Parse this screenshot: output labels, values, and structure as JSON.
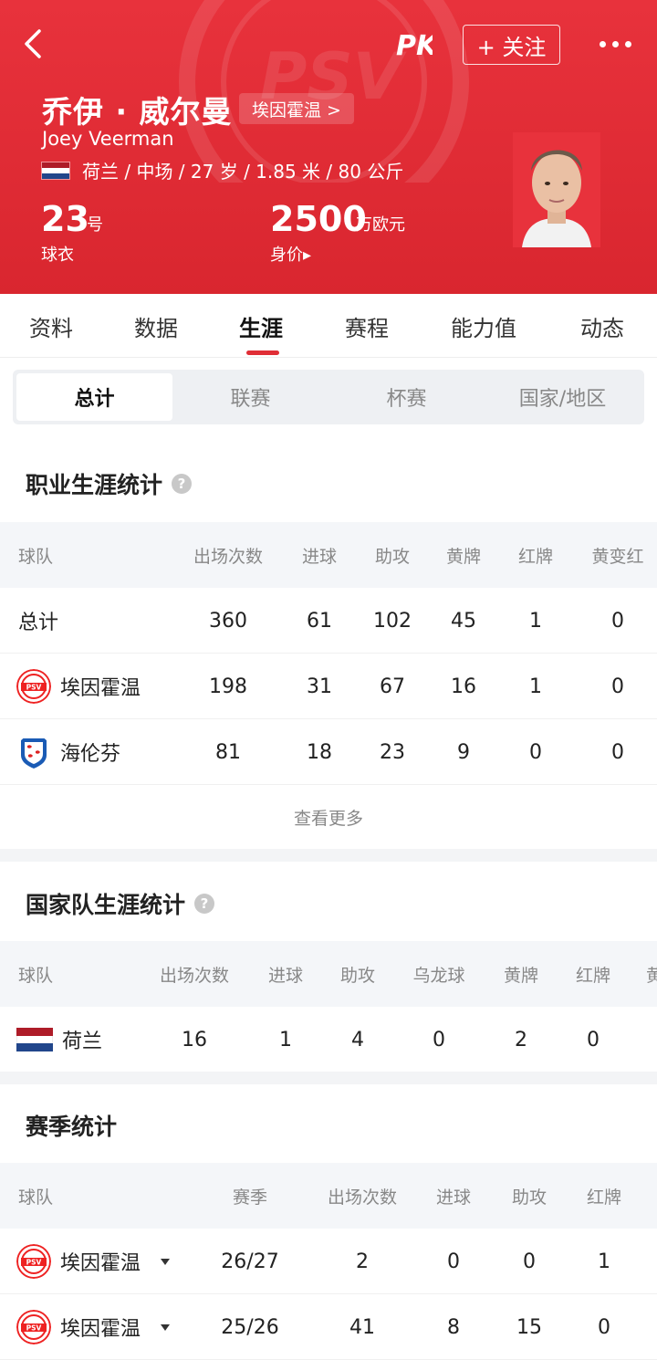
{
  "header": {
    "name_cn": "乔伊 · 威尔曼",
    "club_link": "埃因霍温 >",
    "name_en": "Joey Veerman",
    "profile_line": "荷兰 / 中场 / 27 岁 / 1.85 米 / 80 公斤",
    "shirt_number": "23",
    "shirt_unit": "号",
    "shirt_label": "球衣",
    "value_number": "2500",
    "value_unit": "万欧元",
    "value_label": "身价▸",
    "follow_label": "+ 关注",
    "brand_color": "#e02e36"
  },
  "tabs": [
    "资料",
    "数据",
    "生涯",
    "赛程",
    "能力值",
    "动态"
  ],
  "active_tab": "生涯",
  "segments": [
    "总计",
    "联赛",
    "杯赛",
    "国家/地区"
  ],
  "career": {
    "title": "职业生涯统计",
    "columns": [
      "球队",
      "出场次数",
      "进球",
      "助攻",
      "黄牌",
      "红牌",
      "黄变红"
    ],
    "rows": [
      {
        "team": "总计",
        "apps": "360",
        "goals": "61",
        "assists": "102",
        "yellow": "45",
        "red": "1",
        "yr": "0"
      },
      {
        "team": "埃因霍温",
        "apps": "198",
        "goals": "31",
        "assists": "67",
        "yellow": "16",
        "red": "1",
        "yr": "0"
      },
      {
        "team": "海伦芬",
        "apps": "81",
        "goals": "18",
        "assists": "23",
        "yellow": "9",
        "red": "0",
        "yr": "0"
      }
    ],
    "more_label": "查看更多"
  },
  "national": {
    "title": "国家队生涯统计",
    "columns": [
      "球队",
      "出场次数",
      "进球",
      "助攻",
      "乌龙球",
      "黄牌",
      "红牌",
      "黄"
    ],
    "rows": [
      {
        "team": "荷兰",
        "apps": "16",
        "goals": "1",
        "assists": "4",
        "own": "0",
        "yellow": "2",
        "red": "0"
      }
    ]
  },
  "season": {
    "title": "赛季统计",
    "columns": [
      "球队",
      "赛季",
      "出场次数",
      "进球",
      "助攻",
      "红牌"
    ],
    "rows": [
      {
        "team": "埃因霍温",
        "season": "26/27",
        "apps": "2",
        "goals": "0",
        "assists": "0",
        "red": "1"
      },
      {
        "team": "埃因霍温",
        "season": "25/26",
        "apps": "41",
        "goals": "8",
        "assists": "15",
        "red": "0"
      }
    ]
  },
  "icons": {
    "back": "back-arrow-icon",
    "more": "more-dots-icon",
    "help": "question-icon",
    "psv": "psv-badge-icon",
    "heerenveen": "heerenveen-badge-icon",
    "flag": "netherlands-flag-icon"
  }
}
